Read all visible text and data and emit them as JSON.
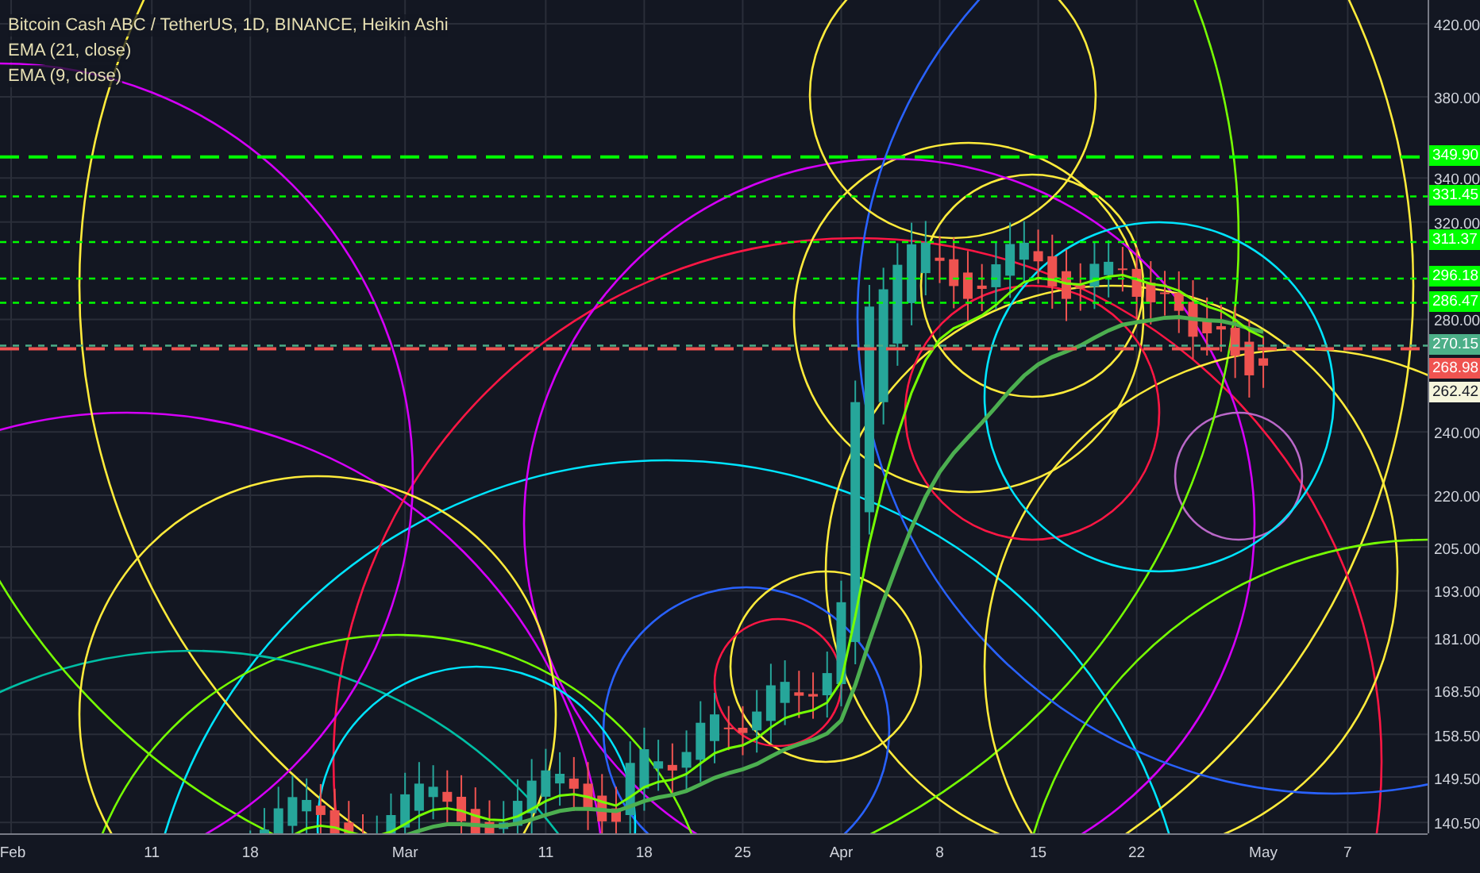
{
  "legend": [
    "Bitcoin Cash ABC / TetherUS, 1D, BINANCE, Heikin Ashi",
    "EMA (21, close)",
    "EMA (9, close)"
  ],
  "price_axis": [
    "420.00",
    "380.00",
    "340.00",
    "320.00",
    "280.00",
    "240.00",
    "220.00",
    "205.00",
    "193.00",
    "181.00",
    "168.50",
    "158.50",
    "149.50",
    "140.50"
  ],
  "price_badges": [
    {
      "label": "349.90",
      "color": "#00ff00",
      "kind": "dashed"
    },
    {
      "label": "331.45",
      "color": "#00ff00",
      "kind": "dotted"
    },
    {
      "label": "311.37",
      "color": "#00ff00",
      "kind": "dotted"
    },
    {
      "label": "296.18",
      "color": "#00ff00",
      "kind": "dotted"
    },
    {
      "label": "286.47",
      "color": "#00ff00",
      "kind": "dotted"
    },
    {
      "label": "270.15",
      "color": "#4caf88",
      "kind": "dotted"
    },
    {
      "label": "268.98",
      "color": "#ef5350",
      "kind": "dashed"
    },
    {
      "label": "262.42",
      "color": "#f5f5dc",
      "kind": "none"
    }
  ],
  "time_axis": [
    "Feb",
    "11",
    "18",
    "Mar",
    "11",
    "18",
    "25",
    "Apr",
    "8",
    "15",
    "22",
    "May",
    "7"
  ]
}
